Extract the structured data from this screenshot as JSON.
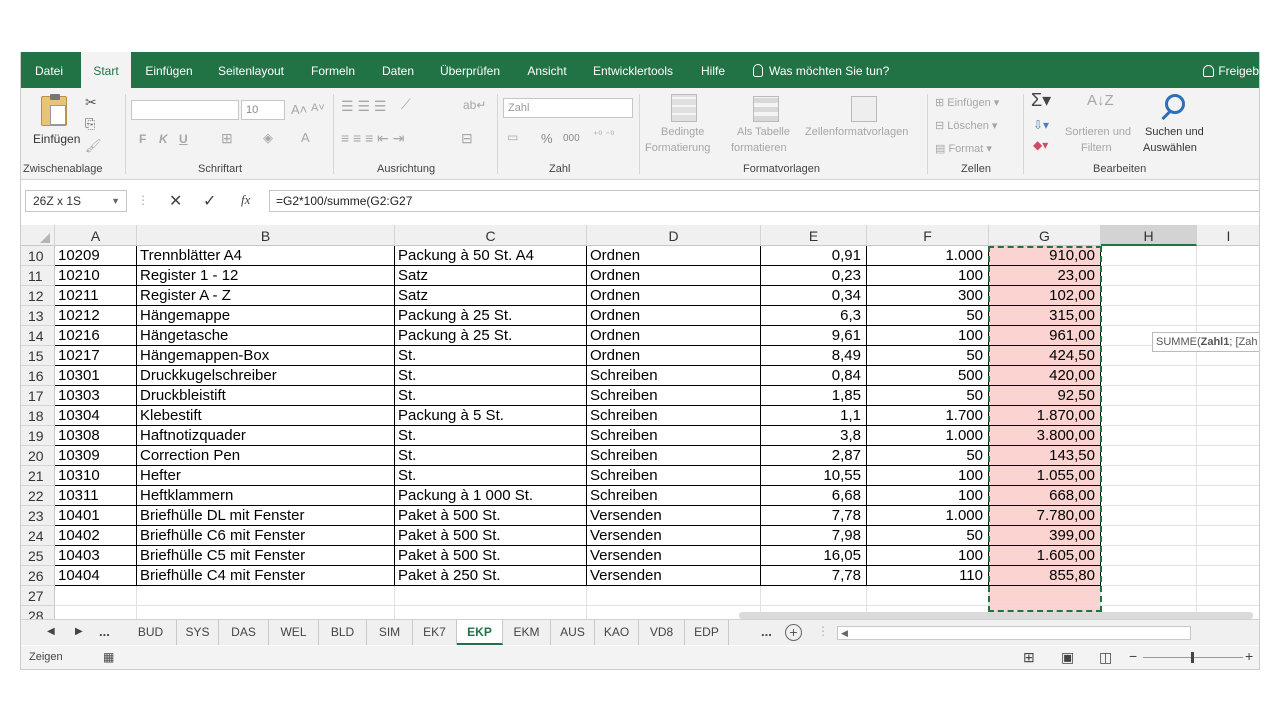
{
  "menu": {
    "tabs": [
      "Datei",
      "Start",
      "Einfügen",
      "Seitenlayout",
      "Formeln",
      "Daten",
      "Überprüfen",
      "Ansicht",
      "Entwicklertools",
      "Hilfe"
    ],
    "active": "Start",
    "tellme": "Was möchten Sie tun?",
    "user": "Freigeb"
  },
  "ribbon": {
    "clipboard": {
      "paste": "Einfügen",
      "label": "Zwischenablage"
    },
    "font": {
      "name": "",
      "size": "10",
      "bold": "F",
      "italic": "K",
      "underline": "U",
      "label": "Schriftart"
    },
    "alignment": {
      "label": "Ausrichtung"
    },
    "number": {
      "format": "Zahl",
      "percent": "%",
      "thousands": "000",
      "label": "Zahl"
    },
    "styles": {
      "cond": "Bedingte",
      "cond2": "Formatierung",
      "table": "Als Tabelle",
      "table2": "formatieren",
      "cell": "Zellenformatvorlagen",
      "label": "Formatvorlagen"
    },
    "cells": {
      "insert": "Einfügen",
      "delete": "Löschen",
      "format": "Format",
      "label": "Zellen"
    },
    "editing": {
      "sort": "Sortieren und",
      "sort2": "Filtern",
      "find": "Suchen und",
      "find2": "Auswählen",
      "label": "Bearbeiten"
    }
  },
  "formula_bar": {
    "name_box": "26Z x 1S",
    "formula": "=G2*100/summe(G2:G27"
  },
  "columns": [
    "A",
    "B",
    "C",
    "D",
    "E",
    "F",
    "G",
    "H",
    "I"
  ],
  "rows": [
    {
      "n": "10",
      "a": "10209",
      "b": "Trennblätter A4",
      "c": "Packung à 50 St. A4",
      "d": "Ordnen",
      "e": "0,91",
      "f": "1.000",
      "g": "910,00"
    },
    {
      "n": "11",
      "a": "10210",
      "b": "Register 1 - 12",
      "c": "Satz",
      "d": "Ordnen",
      "e": "0,23",
      "f": "100",
      "g": "23,00"
    },
    {
      "n": "12",
      "a": "10211",
      "b": "Register A - Z",
      "c": "Satz",
      "d": "Ordnen",
      "e": "0,34",
      "f": "300",
      "g": "102,00"
    },
    {
      "n": "13",
      "a": "10212",
      "b": "Hängemappe",
      "c": "Packung à 25 St.",
      "d": "Ordnen",
      "e": "6,3",
      "f": "50",
      "g": "315,00"
    },
    {
      "n": "14",
      "a": "10216",
      "b": "Hängetasche",
      "c": "Packung à 25 St.",
      "d": "Ordnen",
      "e": "9,61",
      "f": "100",
      "g": "961,00"
    },
    {
      "n": "15",
      "a": "10217",
      "b": "Hängemappen-Box",
      "c": "St.",
      "d": "Ordnen",
      "e": "8,49",
      "f": "50",
      "g": "424,50"
    },
    {
      "n": "16",
      "a": "10301",
      "b": "Druckkugelschreiber",
      "c": "St.",
      "d": "Schreiben",
      "e": "0,84",
      "f": "500",
      "g": "420,00"
    },
    {
      "n": "17",
      "a": "10303",
      "b": "Druckbleistift",
      "c": "St.",
      "d": "Schreiben",
      "e": "1,85",
      "f": "50",
      "g": "92,50"
    },
    {
      "n": "18",
      "a": "10304",
      "b": "Klebestift",
      "c": "Packung à 5 St.",
      "d": "Schreiben",
      "e": "1,1",
      "f": "1.700",
      "g": "1.870,00"
    },
    {
      "n": "19",
      "a": "10308",
      "b": "Haftnotizquader",
      "c": "St.",
      "d": "Schreiben",
      "e": "3,8",
      "f": "1.000",
      "g": "3.800,00"
    },
    {
      "n": "20",
      "a": "10309",
      "b": "Correction Pen",
      "c": "St.",
      "d": "Schreiben",
      "e": "2,87",
      "f": "50",
      "g": "143,50"
    },
    {
      "n": "21",
      "a": "10310",
      "b": "Hefter",
      "c": "St.",
      "d": "Schreiben",
      "e": "10,55",
      "f": "100",
      "g": "1.055,00"
    },
    {
      "n": "22",
      "a": "10311",
      "b": "Heftklammern",
      "c": "Packung à 1 000 St.",
      "d": "Schreiben",
      "e": "6,68",
      "f": "100",
      "g": "668,00"
    },
    {
      "n": "23",
      "a": "10401",
      "b": "Briefhülle DL mit Fenster",
      "c": "Paket à 500 St.",
      "d": "Versenden",
      "e": "7,78",
      "f": "1.000",
      "g": "7.780,00"
    },
    {
      "n": "24",
      "a": "10402",
      "b": "Briefhülle C6 mit Fenster",
      "c": "Paket à 500 St.",
      "d": "Versenden",
      "e": "7,98",
      "f": "50",
      "g": "399,00"
    },
    {
      "n": "25",
      "a": "10403",
      "b": "Briefhülle C5 mit Fenster",
      "c": "Paket à 500 St.",
      "d": "Versenden",
      "e": "16,05",
      "f": "100",
      "g": "1.605,00"
    },
    {
      "n": "26",
      "a": "10404",
      "b": "Briefhülle C4 mit Fenster",
      "c": "Paket à 250 St.",
      "d": "Versenden",
      "e": "7,78",
      "f": "110",
      "g": "855,80"
    },
    {
      "n": "27",
      "a": "",
      "b": "",
      "c": "",
      "d": "",
      "e": "",
      "f": "",
      "g": ""
    },
    {
      "n": "28",
      "a": "",
      "b": "",
      "c": "",
      "d": "",
      "e": "",
      "f": "",
      "g": ""
    }
  ],
  "tooltip": {
    "fn": "SUMME(",
    "arg": "Zahl1",
    "rest": "; [Zah"
  },
  "sheets": [
    "BUD",
    "SYS",
    "DAS",
    "WEL",
    "BLD",
    "SIM",
    "EK7",
    "EKP",
    "EKM",
    "AUS",
    "KAO",
    "VD8",
    "EDP"
  ],
  "active_sheet": "EKP",
  "ellipsis": "...",
  "status": {
    "mode": "Zeigen"
  },
  "colors": {
    "accent": "#217346",
    "highlight": "#fbd3d1"
  }
}
